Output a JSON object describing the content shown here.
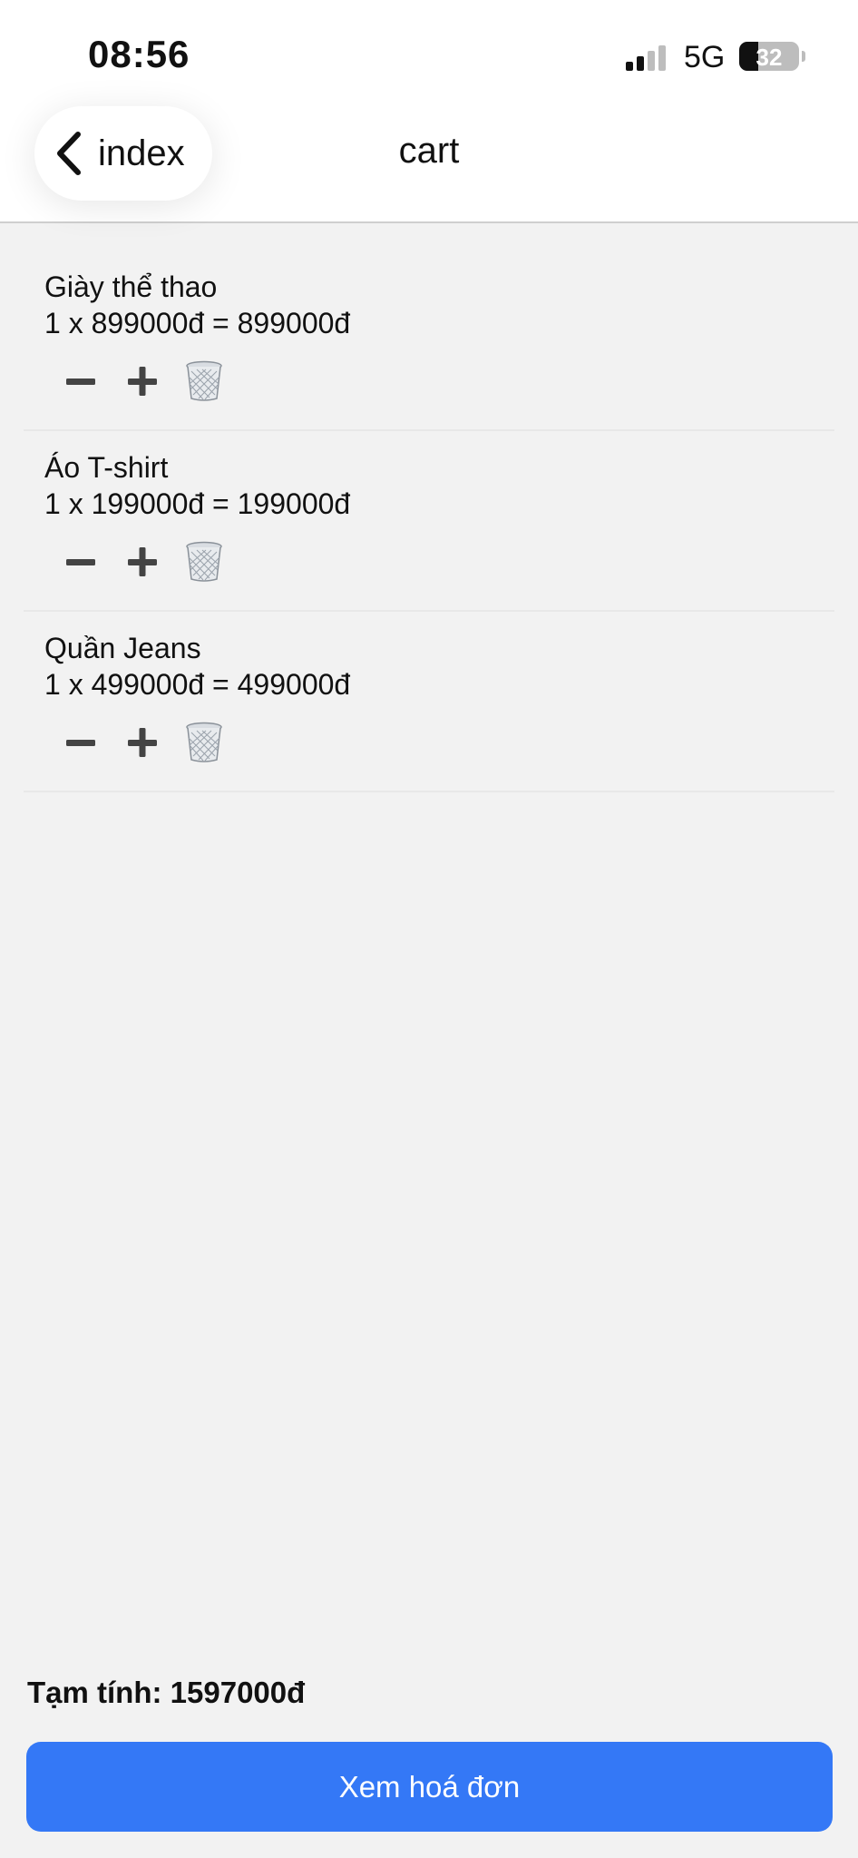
{
  "status_bar": {
    "time": "08:56",
    "network": "5G",
    "battery_percent": "32"
  },
  "nav": {
    "back_label": "index",
    "title": "cart"
  },
  "cart": {
    "items": [
      {
        "name": "Giày thể thao",
        "line": "1 x 899000đ = 899000đ"
      },
      {
        "name": "Áo T-shirt",
        "line": "1 x 199000đ = 199000đ"
      },
      {
        "name": "Quần Jeans",
        "line": "1 x 499000đ = 499000đ"
      }
    ]
  },
  "summary": {
    "subtotal": "Tạm tính: 1597000đ"
  },
  "actions": {
    "checkout_label": "Xem hoá đơn"
  },
  "icons": {
    "minus": "minus-icon",
    "plus": "plus-icon",
    "trash": "trash-icon",
    "back": "chevron-left-icon"
  },
  "colors": {
    "accent": "#3478f6",
    "background": "#f2f2f2"
  }
}
